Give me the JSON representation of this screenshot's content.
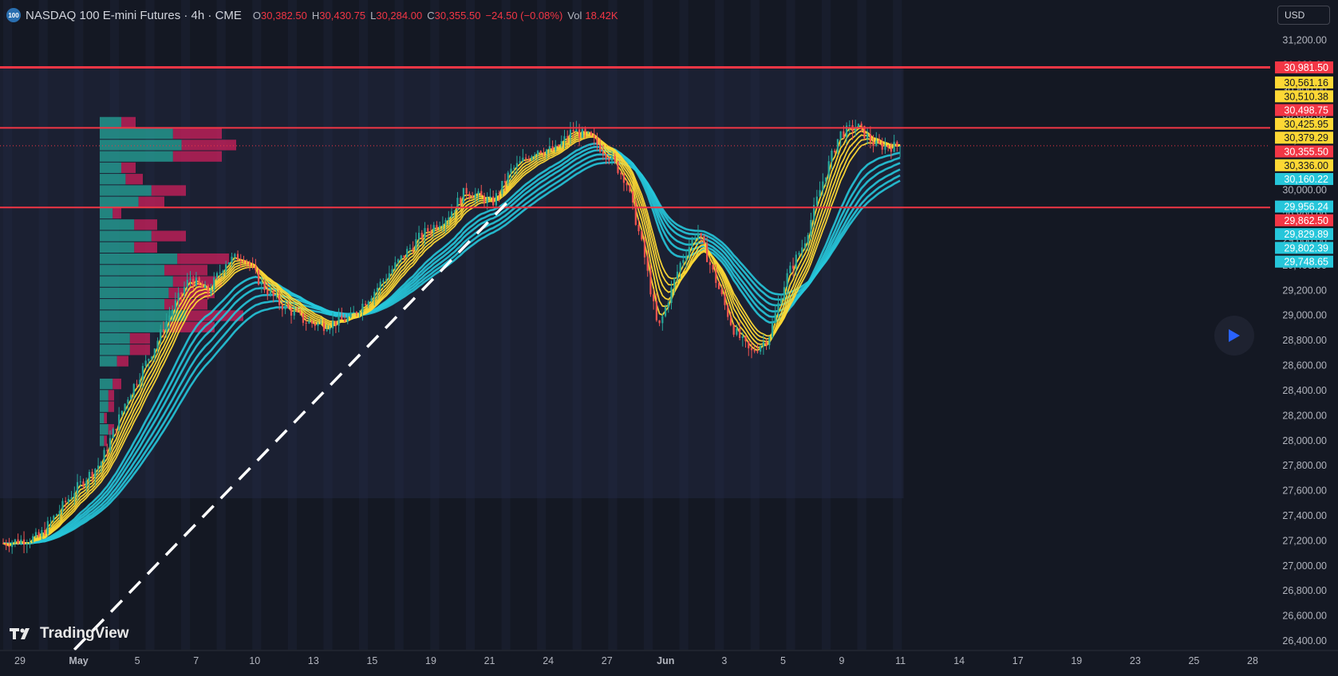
{
  "header": {
    "symbol_badge": "100",
    "title": "NASDAQ 100 E-mini Futures · 4h · CME",
    "open_label": "O",
    "open": "30,382.50",
    "high_label": "H",
    "high": "30,430.75",
    "low_label": "L",
    "low": "30,284.00",
    "close_label": "C",
    "close": "30,355.50",
    "change": "−24.50 (−0.08%)",
    "vol_label": "Vol",
    "vol": "18.42K"
  },
  "currency": "USD",
  "brand": "TradingView",
  "colors": {
    "background": "#141823",
    "up_candle": "#26a69a",
    "down_candle": "#ef5350",
    "fast_ema": "#fdd835",
    "slow_ema": "#26c6da",
    "resistance": "#f23645",
    "trendline": "#ffffff"
  },
  "chart_data": {
    "type": "candlestick",
    "timeframe": "4h",
    "y_ticks": [
      31400,
      31200,
      31000,
      30800,
      30600,
      30400,
      30200,
      30000,
      29800,
      29600,
      29400,
      29200,
      29000,
      28800,
      28600,
      28400,
      28200,
      28000,
      27800,
      27600,
      27400,
      27200,
      27000,
      26800,
      26600,
      26400
    ],
    "ylim": [
      26330,
      31520
    ],
    "x_ticks": [
      "29",
      "May",
      "5",
      "7",
      "10",
      "13",
      "15",
      "19",
      "21",
      "24",
      "27",
      "Jun",
      "3",
      "5",
      "9",
      "11",
      "14",
      "17",
      "19",
      "23",
      "25",
      "28"
    ],
    "bold_x_ticks": [
      "May",
      "Jun"
    ],
    "price_path": [
      [
        0,
        27180
      ],
      [
        2,
        27230
      ],
      [
        4,
        27600
      ],
      [
        5.5,
        27830
      ],
      [
        7,
        28350
      ],
      [
        8.5,
        28750
      ],
      [
        9.5,
        29050
      ],
      [
        10.5,
        29300
      ],
      [
        11.5,
        29180
      ],
      [
        12.5,
        29430
      ],
      [
        13.5,
        29480
      ],
      [
        14.5,
        29250
      ],
      [
        15.5,
        29100
      ],
      [
        17,
        28950
      ],
      [
        18,
        28920
      ],
      [
        19.5,
        28980
      ],
      [
        21,
        29220
      ],
      [
        22.5,
        29480
      ],
      [
        23.5,
        29640
      ],
      [
        25,
        29800
      ],
      [
        26,
        30000
      ],
      [
        27.5,
        29900
      ],
      [
        28.5,
        30150
      ],
      [
        30,
        30330
      ],
      [
        31,
        30320
      ],
      [
        32,
        30480
      ],
      [
        33,
        30420
      ],
      [
        34,
        30280
      ],
      [
        35,
        30080
      ],
      [
        36,
        29500
      ],
      [
        36.8,
        28880
      ],
      [
        38,
        29400
      ],
      [
        39,
        29680
      ],
      [
        40,
        29300
      ],
      [
        41,
        28900
      ],
      [
        42,
        28700
      ],
      [
        43,
        28820
      ],
      [
        44,
        29300
      ],
      [
        45,
        29580
      ],
      [
        46,
        30050
      ],
      [
        47,
        30450
      ],
      [
        48,
        30510
      ],
      [
        49,
        30360
      ],
      [
        50,
        30350
      ],
      [
        50.4,
        30355.5
      ]
    ],
    "resistance_levels": [
      30981.5,
      30498.75,
      29862.5
    ],
    "last_price": 30355.5,
    "trendline": [
      [
        4,
        26330
      ],
      [
        28.3,
        29900
      ]
    ],
    "price_labels": [
      {
        "text": "30,981.50",
        "value": 30981.5,
        "color": "#f23645"
      },
      {
        "text": "30,561.16",
        "value": 30861.16,
        "color": "#fdd835"
      },
      {
        "text": "30,510.38",
        "value": 30750.38,
        "color": "#fdd835"
      },
      {
        "text": "30,498.75",
        "value": 30640.75,
        "color": "#f23645"
      },
      {
        "text": "30,425.95",
        "value": 30530,
        "color": "#fdd835"
      },
      {
        "text": "30,379.29",
        "value": 30420,
        "color": "#fdd835"
      },
      {
        "text": "30,355.50",
        "value": 30310,
        "color": "#f23645"
      },
      {
        "text": "30,336.00",
        "value": 30200,
        "color": "#fdd835"
      },
      {
        "text": "30,160.22",
        "value": 30090,
        "color": "#26c6da"
      },
      {
        "text": "29,956.24",
        "value": 29870,
        "color": "#26c6da"
      },
      {
        "text": "29,862.50",
        "value": 29760,
        "color": "#f23645"
      },
      {
        "text": "29,829.89",
        "value": 29650,
        "color": "#26c6da"
      },
      {
        "text": "29,802.39",
        "value": 29540,
        "color": "#26c6da"
      },
      {
        "text": "29,748.65",
        "value": 29430,
        "color": "#26c6da"
      }
    ],
    "fast_ema_periods": [
      3,
      5,
      7,
      9,
      11,
      13
    ],
    "slow_ema_periods": [
      22,
      26,
      30,
      35,
      40,
      45
    ]
  }
}
